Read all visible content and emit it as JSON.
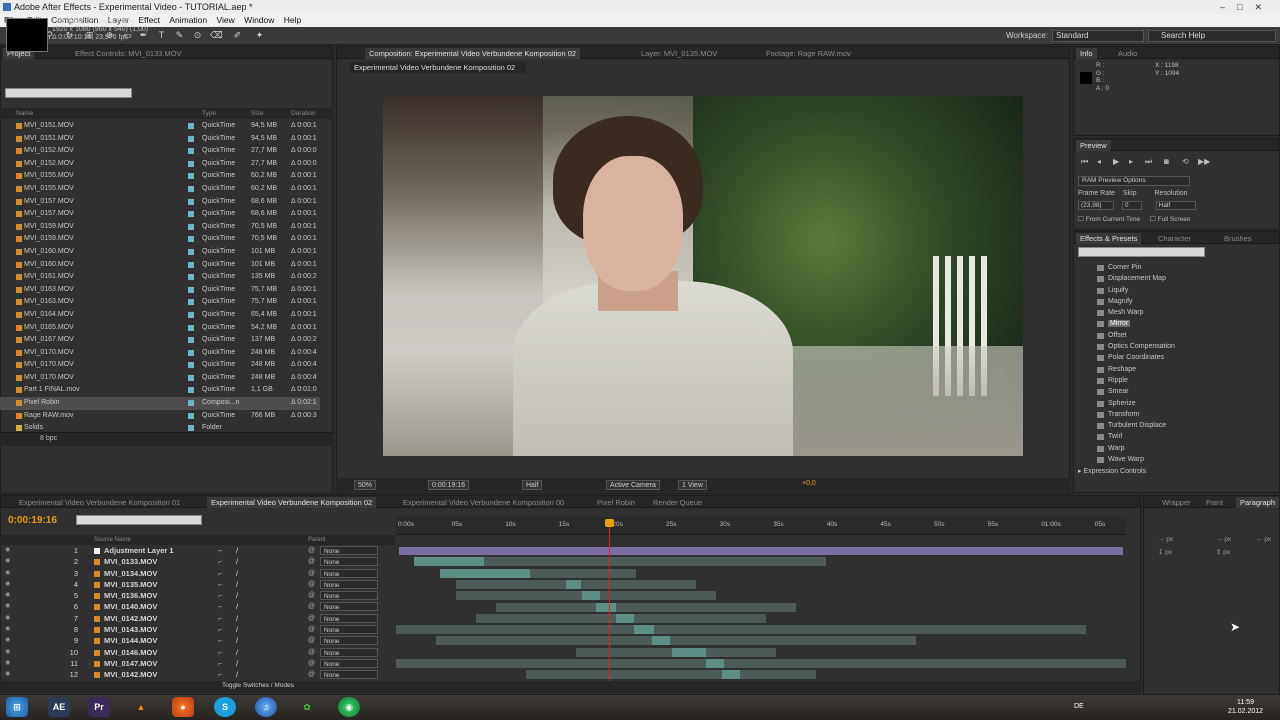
{
  "window": {
    "title": "Adobe After Effects - Experimental Video - TUTORIAL.aep *",
    "controls": [
      "–",
      "□",
      "✕"
    ]
  },
  "menu": [
    "File",
    "Edit",
    "Composition",
    "Layer",
    "Effect",
    "Animation",
    "View",
    "Window",
    "Help"
  ],
  "toolbar": {
    "workspace_label": "Workspace:",
    "workspace_value": "Standard",
    "search_placeholder": "Search Help"
  },
  "project_panel": {
    "tabs": [
      "Project",
      "Effect Controls: MVI_0133.MOV"
    ],
    "selected_item": "Pixel Robin ▾ , used 1 time",
    "info_lines": [
      "1920 x 1080  (960 x 540) (1,00)",
      "Δ 0:02:10:16, 23,976 fps"
    ],
    "columns": [
      "Name",
      "Type",
      "Size",
      "Duration"
    ],
    "items": [
      {
        "name": "MVI_0151.MOV",
        "type": "QuickTime",
        "size": "94,5 MB",
        "dur": "Δ 0:00:1"
      },
      {
        "name": "MVI_0151.MOV",
        "type": "QuickTime",
        "size": "94,5 MB",
        "dur": "Δ 0:00:1"
      },
      {
        "name": "MVI_0152.MOV",
        "type": "QuickTime",
        "size": "27,7 MB",
        "dur": "Δ 0:00:0"
      },
      {
        "name": "MVI_0152.MOV",
        "type": "QuickTime",
        "size": "27,7 MB",
        "dur": "Δ 0:00:0"
      },
      {
        "name": "MVI_0155.MOV",
        "type": "QuickTime",
        "size": "60,2 MB",
        "dur": "Δ 0:00:1"
      },
      {
        "name": "MVI_0155.MOV",
        "type": "QuickTime",
        "size": "60,2 MB",
        "dur": "Δ 0:00:1"
      },
      {
        "name": "MVI_0157.MOV",
        "type": "QuickTime",
        "size": "68,6 MB",
        "dur": "Δ 0:00:1"
      },
      {
        "name": "MVI_0157.MOV",
        "type": "QuickTime",
        "size": "68,6 MB",
        "dur": "Δ 0:00:1"
      },
      {
        "name": "MVI_0159.MOV",
        "type": "QuickTime",
        "size": "70,5 MB",
        "dur": "Δ 0:00:1"
      },
      {
        "name": "MVI_0159.MOV",
        "type": "QuickTime",
        "size": "70,5 MB",
        "dur": "Δ 0:00:1"
      },
      {
        "name": "MVI_0160.MOV",
        "type": "QuickTime",
        "size": "101 MB",
        "dur": "Δ 0:00:1"
      },
      {
        "name": "MVI_0160.MOV",
        "type": "QuickTime",
        "size": "101 MB",
        "dur": "Δ 0:00:1"
      },
      {
        "name": "MVI_0161.MOV",
        "type": "QuickTime",
        "size": "135 MB",
        "dur": "Δ 0:00:2"
      },
      {
        "name": "MVI_0163.MOV",
        "type": "QuickTime",
        "size": "75,7 MB",
        "dur": "Δ 0:00:1"
      },
      {
        "name": "MVI_0163.MOV",
        "type": "QuickTime",
        "size": "75,7 MB",
        "dur": "Δ 0:00:1"
      },
      {
        "name": "MVI_0164.MOV",
        "type": "QuickTime",
        "size": "65,4 MB",
        "dur": "Δ 0:00:1"
      },
      {
        "name": "MVI_0165.MOV",
        "type": "QuickTime",
        "size": "54,2 MB",
        "dur": "Δ 0:00:1"
      },
      {
        "name": "MVI_0167.MOV",
        "type": "QuickTime",
        "size": "137 MB",
        "dur": "Δ 0:00:2"
      },
      {
        "name": "MVI_0170.MOV",
        "type": "QuickTime",
        "size": "248 MB",
        "dur": "Δ 0:00:4"
      },
      {
        "name": "MVI_0170.MOV",
        "type": "QuickTime",
        "size": "248 MB",
        "dur": "Δ 0:00:4"
      },
      {
        "name": "MVI_0170.MOV",
        "type": "QuickTime",
        "size": "248 MB",
        "dur": "Δ 0:00:4"
      },
      {
        "name": "Part 1 FINAL.mov",
        "type": "QuickTime",
        "size": "1,1 GB",
        "dur": "Δ 0:01:0"
      },
      {
        "name": "Pixel Robin",
        "type": "Composi...n",
        "size": "",
        "dur": "Δ 0:02:1"
      },
      {
        "name": "Rage RAW.mov",
        "type": "QuickTime",
        "size": "766 MB",
        "dur": "Δ 0:00:3"
      },
      {
        "name": "Solids",
        "type": "Folder",
        "size": "",
        "dur": ""
      }
    ],
    "footer_bpc": "8 bpc"
  },
  "comp_panel": {
    "tabs": [
      "Composition: Experimental Video Verbundene Komposition 02",
      "Layer: MVI_0135.MOV",
      "Footage: Rage RAW.mov"
    ],
    "comp_name": "Experimental Video Verbundene Komposition 02",
    "zoom": "50%",
    "time": "0:00:19:16",
    "resolution": "Half",
    "camera": "Active Camera",
    "view": "1 View",
    "exposure": "+0,0"
  },
  "info_panel": {
    "tabs": [
      "Info",
      "Audio"
    ],
    "rgba": [
      "R :",
      "G :",
      "B :",
      "A : 0"
    ],
    "xy": [
      "X : 1198",
      "Y : 1094"
    ]
  },
  "preview_panel": {
    "title": "Preview",
    "ram_options": "RAM Preview Options",
    "labels": [
      "Frame Rate",
      "Skip",
      "Resolution"
    ],
    "values": [
      "(23,98)",
      "0",
      "Half"
    ],
    "checks": [
      "From Current Time",
      "Full Screen"
    ]
  },
  "effects_panel": {
    "tabs": [
      "Effects & Presets",
      "Character",
      "Brushes"
    ],
    "items": [
      "Corner Pin",
      "Displacement Map",
      "Liquify",
      "Magnify",
      "Mesh Warp",
      "Mirror",
      "Offset",
      "Optics Compensation",
      "Polar Coordinates",
      "Reshape",
      "Ripple",
      "Smear",
      "Spherize",
      "Transform",
      "Turbulent Displace",
      "Twirl",
      "Warp",
      "Wave Warp"
    ],
    "selected": "Mirror",
    "category": "Expression Controls"
  },
  "timeline": {
    "tabs": [
      "Experimental Video Verbundene Komposition 01",
      "Experimental Video Verbundene Komposition 02",
      "Experimental Video Verbundene Komposition 00",
      "Pixel Robin",
      "Render Queue"
    ],
    "current_time": "0:00:19:16",
    "columns": [
      "Source Name",
      "Parent"
    ],
    "ruler": [
      "0:00s",
      "05s",
      "10s",
      "15s",
      "20s",
      "25s",
      "30s",
      "35s",
      "40s",
      "45s",
      "50s",
      "55s",
      "01:00s",
      "05s"
    ],
    "layers": [
      {
        "num": "1",
        "name": "Adjustment Layer 1",
        "parent": "None"
      },
      {
        "num": "2",
        "name": "MVI_0133.MOV",
        "parent": "None"
      },
      {
        "num": "3",
        "name": "MVI_0134.MOV",
        "parent": "None"
      },
      {
        "num": "4",
        "name": "MVI_0135.MOV",
        "parent": "None"
      },
      {
        "num": "5",
        "name": "MVI_0136.MOV",
        "parent": "None"
      },
      {
        "num": "6",
        "name": "MVI_0140.MOV",
        "parent": "None"
      },
      {
        "num": "7",
        "name": "MVI_0142.MOV",
        "parent": "None"
      },
      {
        "num": "8",
        "name": "MVI_0143.MOV",
        "parent": "None"
      },
      {
        "num": "9",
        "name": "MVI_0144.MOV",
        "parent": "None"
      },
      {
        "num": "10",
        "name": "MVI_0146.MOV",
        "parent": "None"
      },
      {
        "num": "11",
        "name": "MVI_0147.MOV",
        "parent": "None"
      },
      {
        "num": "12",
        "name": "MVI_0142.MOV",
        "parent": "None"
      }
    ],
    "toggle_label": "Toggle Switches / Modes"
  },
  "paragraph_panel": {
    "tabs": [
      "Wrapper",
      "Paint",
      "Paragraph"
    ],
    "units": [
      "px",
      "px",
      "px",
      "px",
      "px"
    ]
  },
  "taskbar": {
    "apps": [
      "AE",
      "Pr"
    ],
    "language": "DE",
    "time": "11:59",
    "date": "21.02.2012"
  }
}
